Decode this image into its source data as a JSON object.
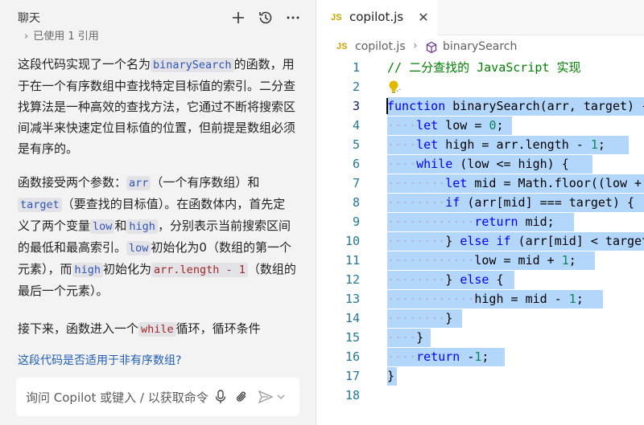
{
  "chat": {
    "title": "聊天",
    "used_refs": "已使用 1 引用",
    "paragraph1": {
      "t1": "这段代码实现了一个名为",
      "code1": "binarySearch",
      "t2": "的函数，用于在一个有序数组中查找特定目标值的索引。二分查找算法是一种高效的查找方法，它通过不断将搜索区间减半来快速定位目标值的位置，但前提是数组必须是有序的。"
    },
    "paragraph2": {
      "t1": "函数接受两个参数：",
      "code_arr": "arr",
      "t2": "（一个有序数组）和",
      "code_target": "target",
      "t3": "（要查找的目标值）。在函数体内，首先定义了两个变量",
      "code_low": "low",
      "t4": "和",
      "code_high": "high",
      "t5": "，分别表示当前搜索区间的最低和最高索引。",
      "code_low2": "low",
      "t6": "初始化为0（数组的第一个元素），而",
      "code_high2": "high",
      "t7": "初始化为",
      "code_len": "arr.length - 1",
      "t8": "（数组的最后一个元素）。"
    },
    "paragraph3": {
      "t1": "接下来，函数进入一个",
      "code_while": "while",
      "t2": "循环，循环条件"
    },
    "suggestion": "这段代码是否适用于非有序数组?",
    "input_placeholder": "询问 Copilot 或键入 / 以获取命令"
  },
  "editor": {
    "tab_badge": "JS",
    "tab_title": "copilot.js",
    "breadcrumb_file": "copilot.js",
    "breadcrumb_symbol": "binarySearch",
    "line_numbers": [
      "1",
      "2",
      "3",
      "4",
      "5",
      "6",
      "7",
      "8",
      "9",
      "10",
      "11",
      "12",
      "13",
      "14",
      "15",
      "16",
      "17",
      "18"
    ],
    "comment_line": "// 二分查找的 JavaScript 实现"
  },
  "colors": {
    "selection": "#b3d6fb",
    "keyword": "#0000ff",
    "comment": "#008000",
    "number": "#098658",
    "link": "#1f5eb5"
  }
}
